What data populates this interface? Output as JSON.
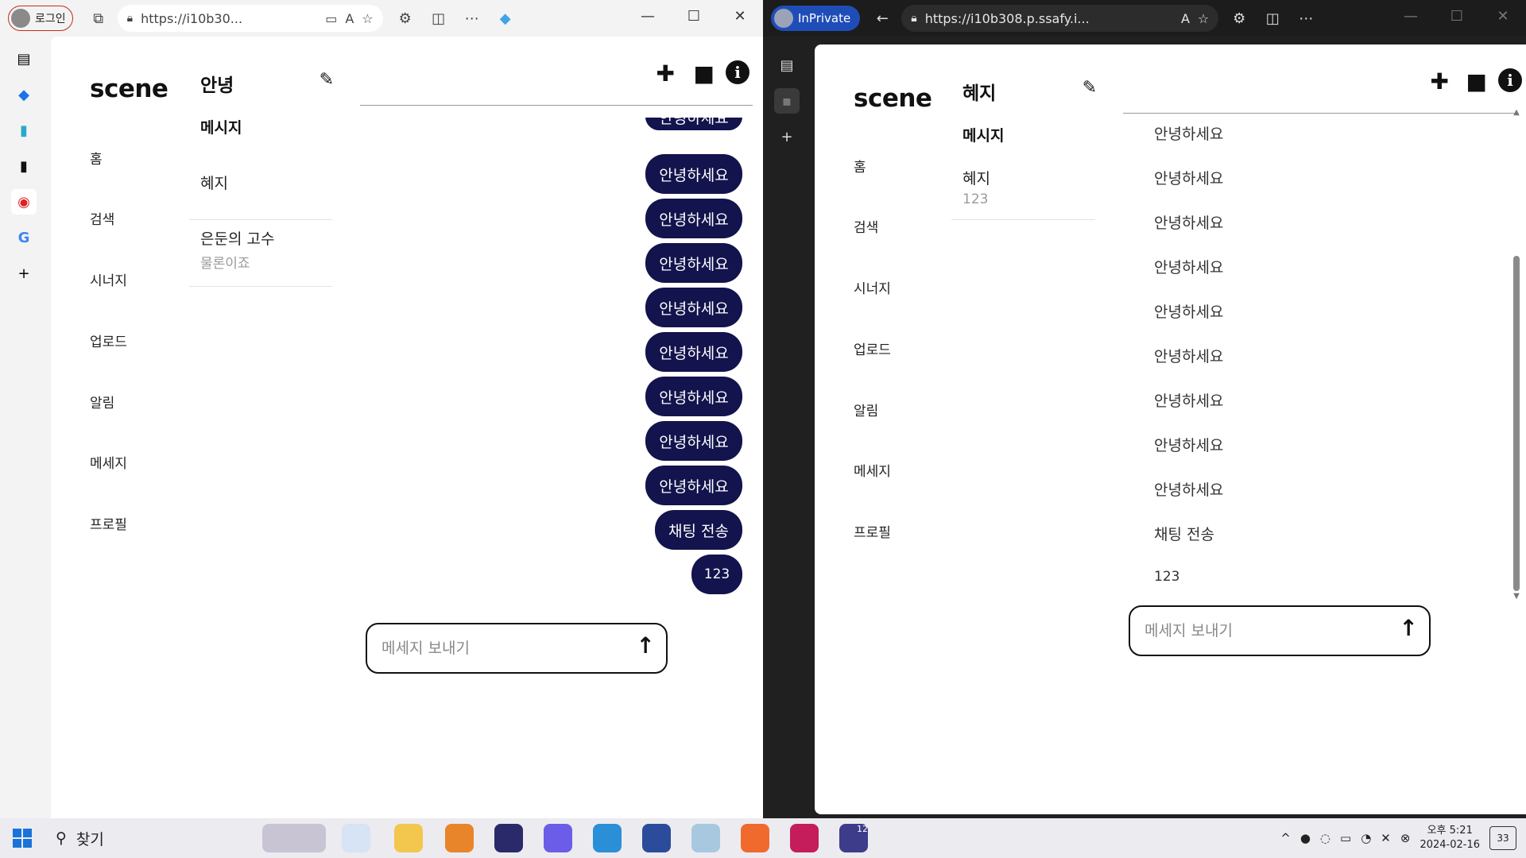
{
  "left_window": {
    "profile_label": "로그인",
    "url": "https://i10b30...",
    "brand": "scene:i",
    "nav": [
      "홈",
      "검색",
      "시너지",
      "업로드",
      "알림",
      "메세지",
      "프로필"
    ],
    "conv_panel": {
      "title": "안녕",
      "section": "메시지",
      "items": [
        {
          "name": "혜지",
          "preview": ""
        },
        {
          "name": "은둔의 고수",
          "preview": "물론이죠"
        }
      ]
    },
    "chat": {
      "partial_top": "안녕하세요",
      "messages": [
        "안녕하세요",
        "안녕하세요",
        "안녕하세요",
        "안녕하세요",
        "안녕하세요",
        "안녕하세요",
        "안녕하세요",
        "안녕하세요",
        "채팅 전송",
        "123"
      ],
      "input_placeholder": "메세지 보내기"
    }
  },
  "right_window": {
    "mode_label": "InPrivate",
    "url": "https://i10b308.p.ssafy.i...",
    "brand": "scene:i",
    "nav": [
      "홈",
      "검색",
      "시너지",
      "업로드",
      "알림",
      "메세지",
      "프로필"
    ],
    "conv_panel": {
      "title": "혜지",
      "section": "메시지",
      "items": [
        {
          "name": "혜지",
          "preview": "123"
        }
      ]
    },
    "chat": {
      "messages": [
        "안녕하세요",
        "안녕하세요",
        "안녕하세요",
        "안녕하세요",
        "안녕하세요",
        "안녕하세요",
        "안녕하세요",
        "안녕하세요",
        "안녕하세요",
        "채팅 전송",
        "123"
      ],
      "input_placeholder": "메세지 보내기"
    }
  },
  "taskbar": {
    "search_label": "찾기",
    "clock_ampm_time": "오후 5:21",
    "clock_date": "2024-02-16",
    "notification_count": "33",
    "badge_count": "12"
  },
  "colors": {
    "bubble": "#13134d",
    "inprivate": "#1f4db8",
    "login_border": "#c42b1c"
  }
}
